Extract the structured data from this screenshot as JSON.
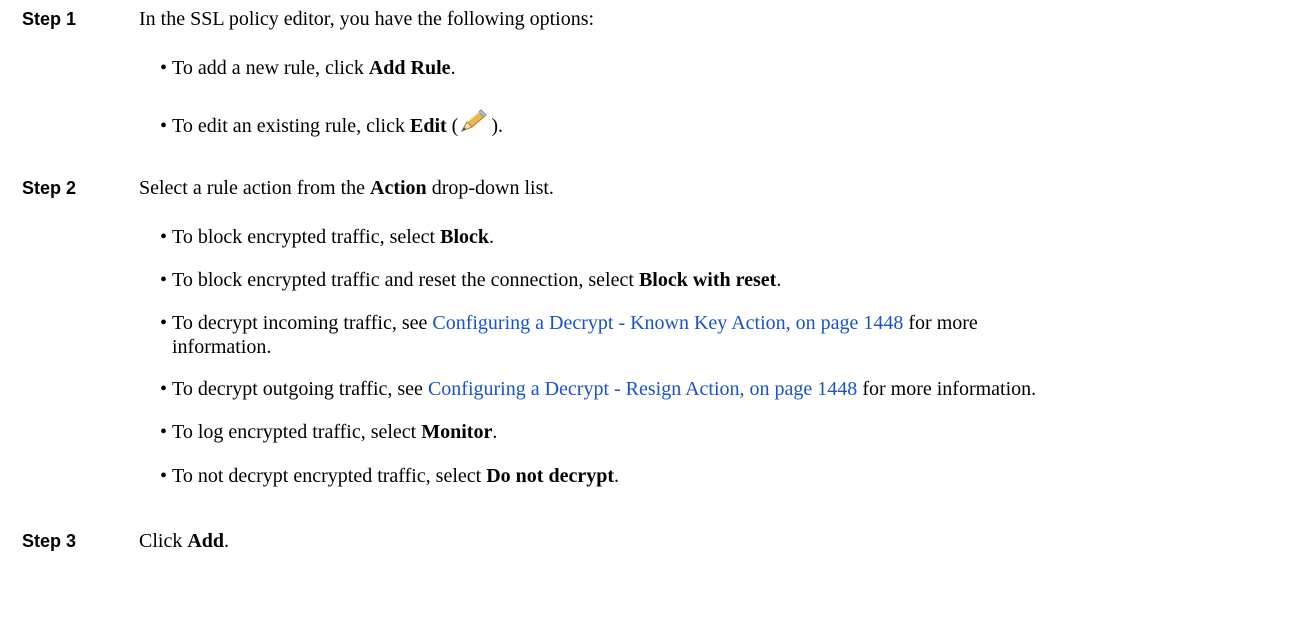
{
  "steps": [
    {
      "label": "Step 1",
      "text": "In the SSL policy editor, you have the following options:",
      "bullets": [
        {
          "pre": "To add a new rule, click ",
          "bold": "Add Rule",
          "post": "."
        },
        {
          "pre": "To edit an existing rule, click ",
          "bold": "Edit",
          "open": " (",
          "icon": "pencil-icon",
          "close": ")."
        }
      ]
    },
    {
      "label": "Step 2",
      "text_pre": "Select a rule action from the ",
      "text_bold": "Action",
      "text_post": " drop-down list.",
      "bullets": [
        {
          "pre": "To block encrypted traffic, select ",
          "bold": "Block",
          "post": "."
        },
        {
          "pre": "To block encrypted traffic and reset the connection, select ",
          "bold": "Block with reset",
          "post": "."
        },
        {
          "pre": "To decrypt incoming traffic, see ",
          "link": "Configuring a Decrypt - Known Key Action, on page 1448",
          "post": " for more",
          "cont": "information."
        },
        {
          "pre": "To decrypt outgoing traffic, see ",
          "link": "Configuring a Decrypt - Resign Action, on page 1448",
          "post": " for more information."
        },
        {
          "pre": "To log encrypted traffic, select ",
          "bold": "Monitor",
          "post": "."
        },
        {
          "pre": "To not decrypt encrypted traffic, select ",
          "bold": "Do not decrypt",
          "post": "."
        }
      ]
    },
    {
      "label": "Step 3",
      "text_pre": "Click ",
      "text_bold": "Add",
      "text_post": "."
    }
  ],
  "colors": {
    "link": "#1a52c9",
    "text": "#000000",
    "background": "#ffffff"
  }
}
